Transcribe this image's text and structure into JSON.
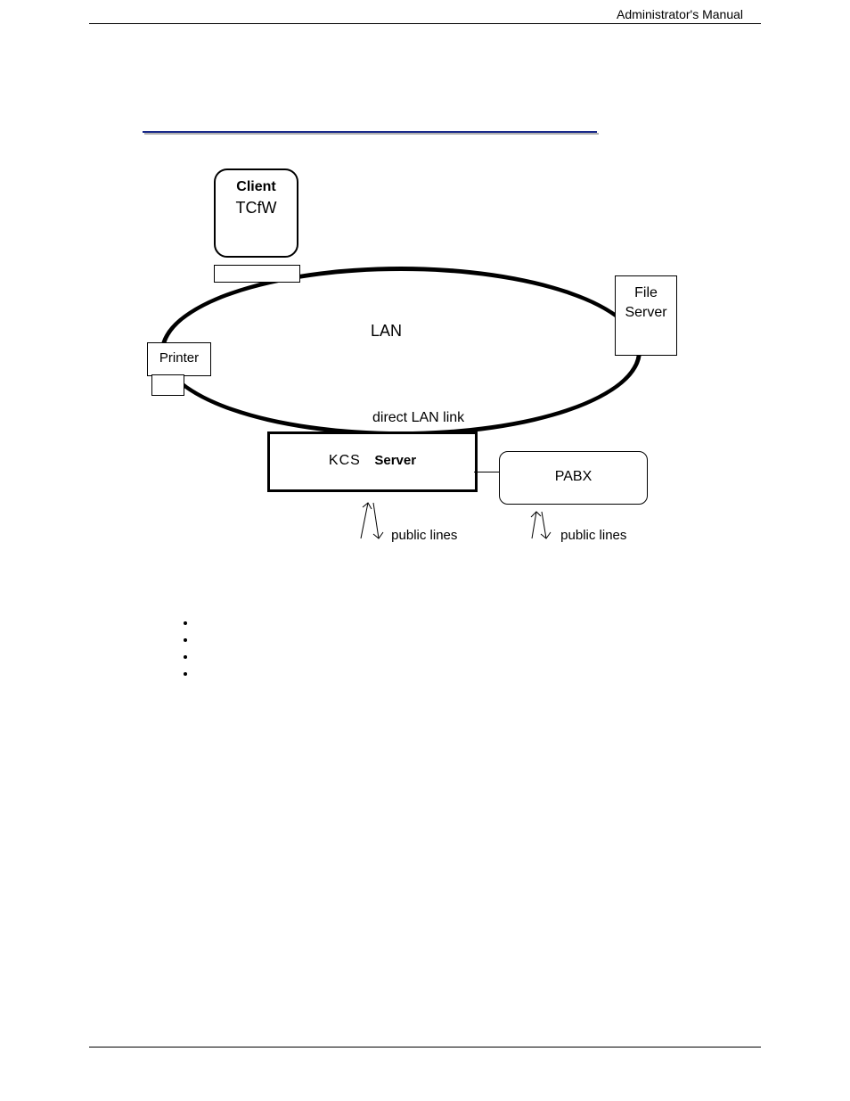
{
  "header": "Administrator's Manual",
  "diagram": {
    "client_title": "Client",
    "client_sub": "TCfW",
    "lan": "LAN",
    "file_server_l1": "File",
    "file_server_l2": "Server",
    "printer": "Printer",
    "direct_lan": "direct LAN link",
    "kcs": "KCS",
    "server": "Server",
    "pabx": "PABX",
    "public_lines_1": "public lines",
    "public_lines_2": "public lines"
  },
  "bullets": [
    "",
    "",
    "",
    ""
  ]
}
